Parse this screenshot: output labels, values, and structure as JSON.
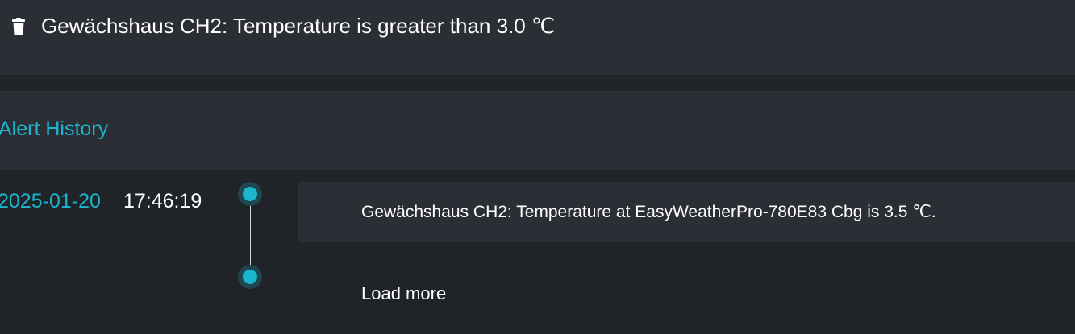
{
  "header": {
    "delete_icon": "trash-icon",
    "title": "Gewächshaus CH2: Temperature is greater than 3.0 ℃"
  },
  "history": {
    "title": "Alert History",
    "entries": [
      {
        "date": "2025-01-20",
        "time": "17:46:19",
        "message": "Gewächshaus CH2: Temperature at EasyWeatherPro-780E83 Cbg is 3.5 ℃."
      }
    ],
    "load_more_label": "Load more"
  },
  "colors": {
    "background": "#202328",
    "panel": "#2b2e35",
    "accent": "#1ab6cd",
    "text": "#ffffff"
  }
}
